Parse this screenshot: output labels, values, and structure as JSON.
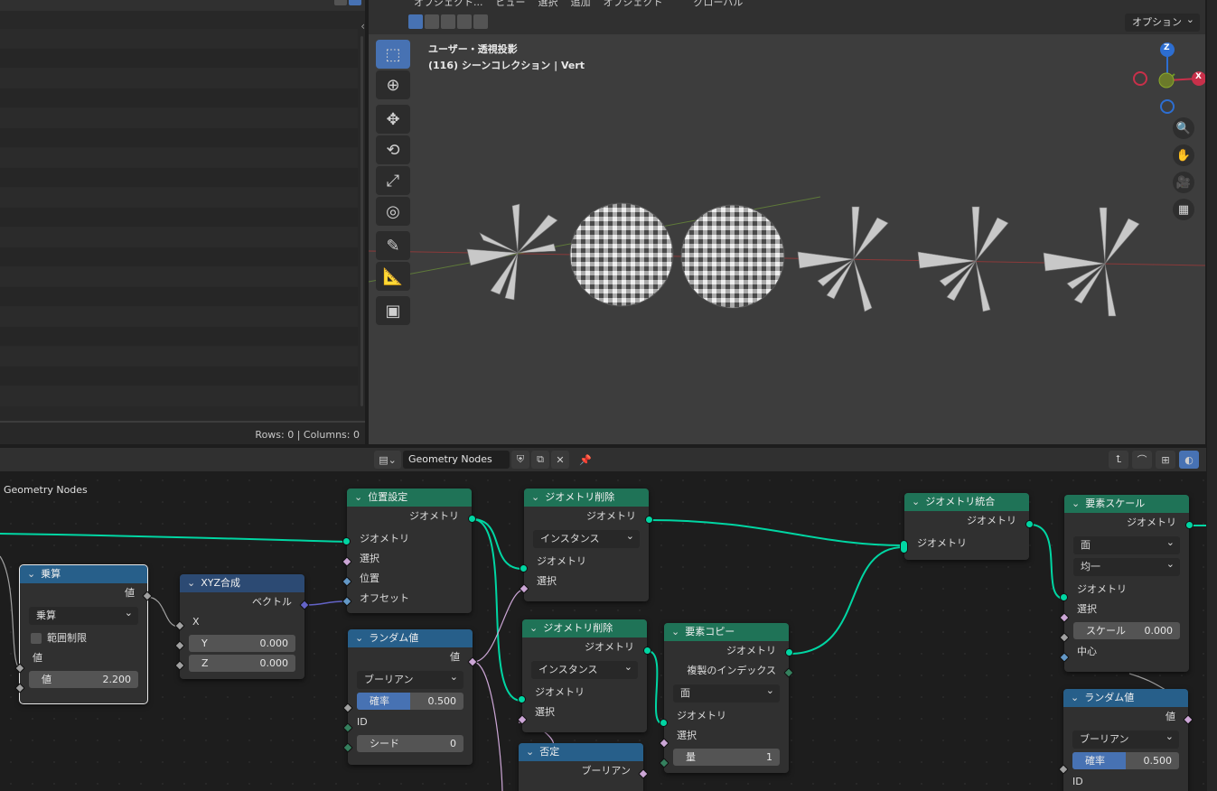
{
  "spreadsheet": {
    "footer": "Rows: 0   |   Columns: 0"
  },
  "viewport": {
    "menu": [
      "オブジェクト...",
      "ビュー",
      "選択",
      "追加",
      "オブジェクト",
      "グローバル"
    ],
    "options_label": "オプション",
    "title": "ユーザー・透視投影",
    "subtitle": "(116) シーンコレクション | Vert",
    "gizmo": {
      "z": "Z",
      "x": "X"
    }
  },
  "node_editor": {
    "tree_name": "Geometry Nodes",
    "breadcrumb": "Geometry Nodes",
    "nodes": {
      "multiply": {
        "title": "乗算",
        "out_value": "値",
        "op": "乗算",
        "clamp": "範囲制限",
        "in_value": "値",
        "field_label": "値",
        "field_value": "2.200"
      },
      "combine_xyz": {
        "title": "XYZ合成",
        "out": "ベクトル",
        "x": "X",
        "y_label": "Y",
        "y_value": "0.000",
        "z_label": "Z",
        "z_value": "0.000"
      },
      "set_position": {
        "title": "位置設定",
        "out": "ジオメトリ",
        "in_geo": "ジオメトリ",
        "in_sel": "選択",
        "in_pos": "位置",
        "in_off": "オフセット"
      },
      "random_value": {
        "title": "ランダム値",
        "out": "値",
        "type": "ブーリアン",
        "prob_label": "確率",
        "prob_value": "0.500",
        "id": "ID",
        "seed_label": "シード",
        "seed_value": "0"
      },
      "delete_geo_1": {
        "title": "ジオメトリ削除",
        "out": "ジオメトリ",
        "domain": "インスタンス",
        "in_geo": "ジオメトリ",
        "in_sel": "選択"
      },
      "delete_geo_2": {
        "title": "ジオメトリ削除",
        "out": "ジオメトリ",
        "domain": "インスタンス",
        "in_geo": "ジオメトリ",
        "in_sel": "選択"
      },
      "not": {
        "title": "否定",
        "out": "ブーリアン"
      },
      "duplicate": {
        "title": "要素コピー",
        "out": "ジオメトリ",
        "out_idx": "複製のインデックス",
        "domain": "面",
        "in_geo": "ジオメトリ",
        "in_sel": "選択",
        "amount_label": "量",
        "amount_value": "1"
      },
      "join": {
        "title": "ジオメトリ統合",
        "out": "ジオメトリ",
        "in_geo": "ジオメトリ"
      },
      "scale": {
        "title": "要素スケール",
        "out": "ジオメトリ",
        "domain": "面",
        "mode": "均一",
        "in_geo": "ジオメトリ",
        "in_sel": "選択",
        "scale_label": "スケール",
        "scale_value": "0.000",
        "center": "中心"
      },
      "random_value_2": {
        "title": "ランダム値",
        "out": "値",
        "type": "ブーリアン",
        "prob_label": "確率",
        "prob_value": "0.500",
        "id": "ID"
      }
    }
  },
  "colors": {
    "accent": "#4772b3",
    "geometry_socket": "#00d6a3",
    "geo_header": "#1f7357",
    "math_header": "#275f8a"
  }
}
